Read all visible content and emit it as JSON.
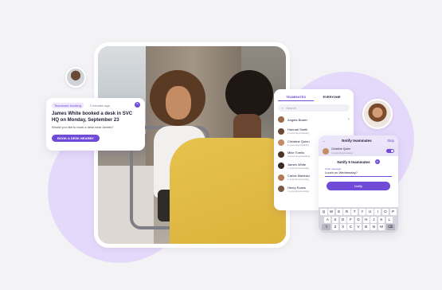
{
  "booking_card": {
    "tag": "Teammate booking",
    "time": "2 minutes ago",
    "close_icon": "×",
    "message": "James White booked a desk in SVC HQ on Monday, September 23",
    "question": "Would you like to book a desk near James?",
    "button": "BOOK A DESK NEARBY"
  },
  "team_panel": {
    "tabs": [
      "TEAMMATES",
      "EVERYONE"
    ],
    "search_placeholder": "Search",
    "people": [
      {
        "name": "Angela Bower",
        "sub": ""
      },
      {
        "name": "Hannah Smith",
        "sub": "1 upcoming booking"
      },
      {
        "name": "Christine Quinn",
        "sub": "1 upcoming booking"
      },
      {
        "name": "Mike Torello",
        "sub": "2 upcoming bookings"
      },
      {
        "name": "James White",
        "sub": "1 upcoming booking"
      },
      {
        "name": "Carlos Martinez",
        "sub": "1 upcoming booking"
      },
      {
        "name": "Henry Evans",
        "sub": "1 upcoming booking"
      }
    ]
  },
  "notify_panel": {
    "back_label": "←",
    "title": "Notify teammates",
    "skip_label": "Skip",
    "friend_name": "Christine Quinn",
    "friend_sub": "1 upcoming booking",
    "subtitle": "Notify 5 teammates",
    "invite_label": "Invite message",
    "invite_value": "Lunch on Wednesday?",
    "button": "Notify",
    "keyboard_rows": [
      [
        "Q",
        "W",
        "E",
        "R",
        "T",
        "Y",
        "U",
        "I",
        "O",
        "P"
      ],
      [
        "A",
        "S",
        "D",
        "F",
        "G",
        "H",
        "J",
        "K",
        "L"
      ],
      [
        "⇧",
        "Z",
        "X",
        "C",
        "V",
        "B",
        "N",
        "M",
        "⌫"
      ]
    ]
  }
}
